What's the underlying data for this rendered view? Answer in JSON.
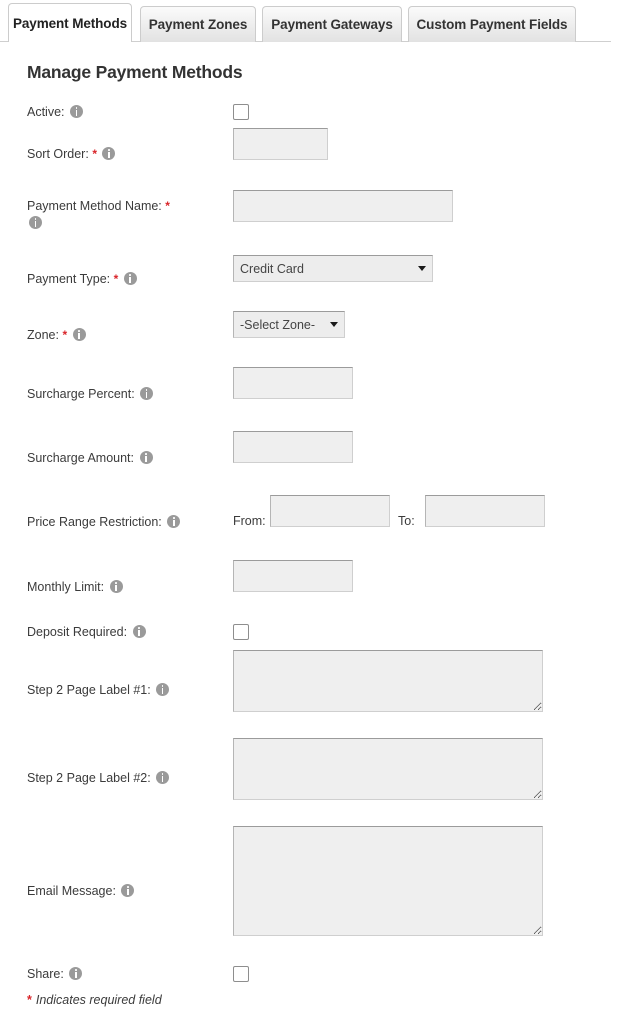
{
  "tabs": [
    {
      "label": "Payment Methods",
      "active": true
    },
    {
      "label": "Payment Zones",
      "active": false
    },
    {
      "label": "Payment Gateways",
      "active": false
    },
    {
      "label": "Custom Payment Fields",
      "active": false
    }
  ],
  "page_title": "Manage Payment Methods",
  "colors": {
    "required_asterisk": "#d9252a",
    "label_text": "#3b3b3b",
    "title_text": "#333333",
    "field_background": "#efefef",
    "select_background": "#ededed",
    "info_icon": "#9a9a9a",
    "tab_active_background": "#ffffff",
    "tab_inactive_background": "#ededed",
    "border": "#cfcfcf",
    "page_background": "#ffffff"
  },
  "fields": {
    "active": {
      "label": "Active:",
      "required": false,
      "control": "checkbox",
      "checked": false,
      "value": ""
    },
    "sort_order": {
      "label": "Sort Order:",
      "required": true,
      "control": "text",
      "value": ""
    },
    "payment_method_name": {
      "label": "Payment Method Name:",
      "required": true,
      "control": "text",
      "value": ""
    },
    "payment_type": {
      "label": "Payment Type:",
      "required": true,
      "control": "select",
      "value": "Credit Card"
    },
    "zone": {
      "label": "Zone:",
      "required": true,
      "control": "select",
      "value": "-Select Zone-"
    },
    "surcharge_percent": {
      "label": "Surcharge Percent:",
      "required": false,
      "control": "text",
      "value": ""
    },
    "surcharge_amount": {
      "label": "Surcharge Amount:",
      "required": false,
      "control": "text",
      "value": ""
    },
    "price_range_restriction": {
      "label": "Price Range Restriction:",
      "required": false,
      "control": "range",
      "from_label": "From:",
      "from_value": "",
      "to_label": "To:",
      "to_value": ""
    },
    "monthly_limit": {
      "label": "Monthly Limit:",
      "required": false,
      "control": "text",
      "value": ""
    },
    "deposit_required": {
      "label": "Deposit Required:",
      "required": false,
      "control": "checkbox",
      "checked": false,
      "value": ""
    },
    "step2_page_label_1": {
      "label": "Step 2 Page Label #1:",
      "required": false,
      "control": "textarea",
      "value": ""
    },
    "step2_page_label_2": {
      "label": "Step 2 Page Label #2:",
      "required": false,
      "control": "textarea",
      "value": ""
    },
    "email_message": {
      "label": "Email Message:",
      "required": false,
      "control": "textarea",
      "value": ""
    },
    "share": {
      "label": "Share:",
      "required": false,
      "control": "checkbox",
      "checked": false,
      "value": ""
    }
  },
  "footnote": {
    "asterisk": "*",
    "text": "Indicates required field"
  }
}
